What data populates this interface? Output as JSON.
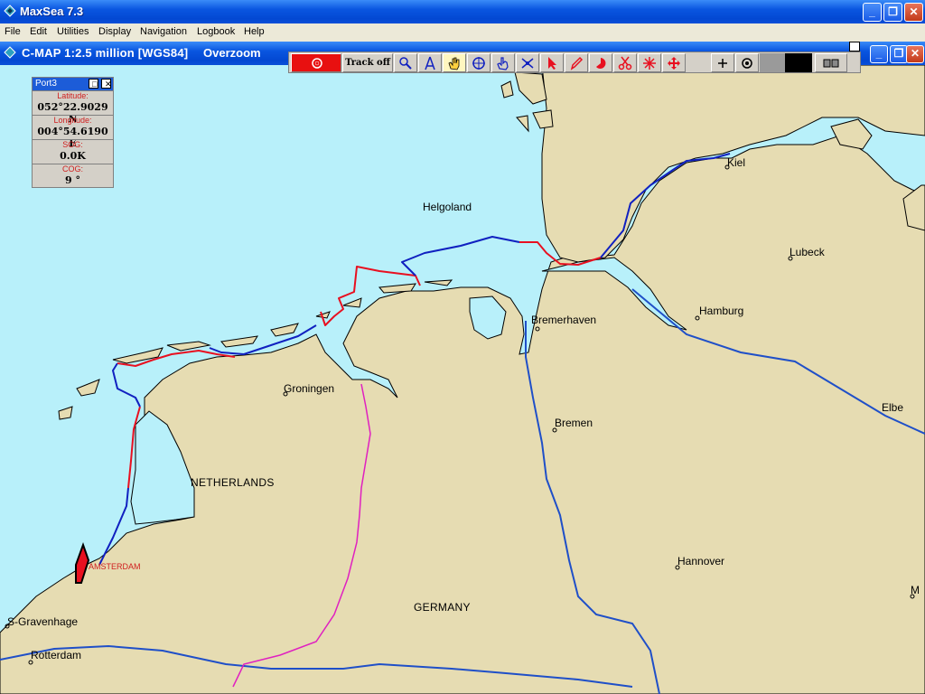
{
  "window": {
    "title": "MaxSea 7.3",
    "min": "_",
    "restore": "❐",
    "close": "✕"
  },
  "menu": {
    "items": [
      "File",
      "Edit",
      "Utilities",
      "Display",
      "Navigation",
      "Logbook",
      "Help"
    ]
  },
  "chart_window": {
    "title": "C-MAP  1:2.5 million [WGS84]",
    "mode": "Overzoom"
  },
  "toolbar": {
    "track_label": "Track off",
    "tools": [
      "record-icon",
      "magnifier-icon",
      "compass-icon",
      "hand-pan-icon",
      "crosshair-icon",
      "hand-point-icon",
      "route-icon",
      "arrow-select-icon",
      "pencil-icon",
      "mark-icon",
      "scissors-icon",
      "target-icon",
      "move-icon",
      "plus-icon",
      "circle-dot-icon"
    ]
  },
  "info_panel": {
    "title": "Port3",
    "rows": [
      {
        "label": "Latitude:",
        "value": "052°22.9029 N"
      },
      {
        "label": "Longitude:",
        "value": "004°54.6190 E"
      },
      {
        "label": "SOG:",
        "value": "0.0K"
      },
      {
        "label": "COG:",
        "value": "9 °"
      }
    ]
  },
  "map": {
    "places": {
      "kiel": "Kiel",
      "helgoland": "Helgoland",
      "lubeck": "Lubeck",
      "hamburg": "Hamburg",
      "bremerhaven": "Bremerhaven",
      "groningen": "Groningen",
      "bremen": "Bremen",
      "elbe": "Elbe",
      "netherlands": "NETHERLANDS",
      "hannover": "Hannover",
      "germany": "GERMANY",
      "gravenhage": "S-Gravenhage",
      "rotterdam": "Rotterdam",
      "amsterdam": "AMSTERDAM",
      "m_edge": "M"
    },
    "colors": {
      "sea": "#b8f0fa",
      "land": "#e6dcb2",
      "track_red": "#e81020",
      "track_blue": "#1020c0",
      "border": "#e020c0"
    }
  }
}
